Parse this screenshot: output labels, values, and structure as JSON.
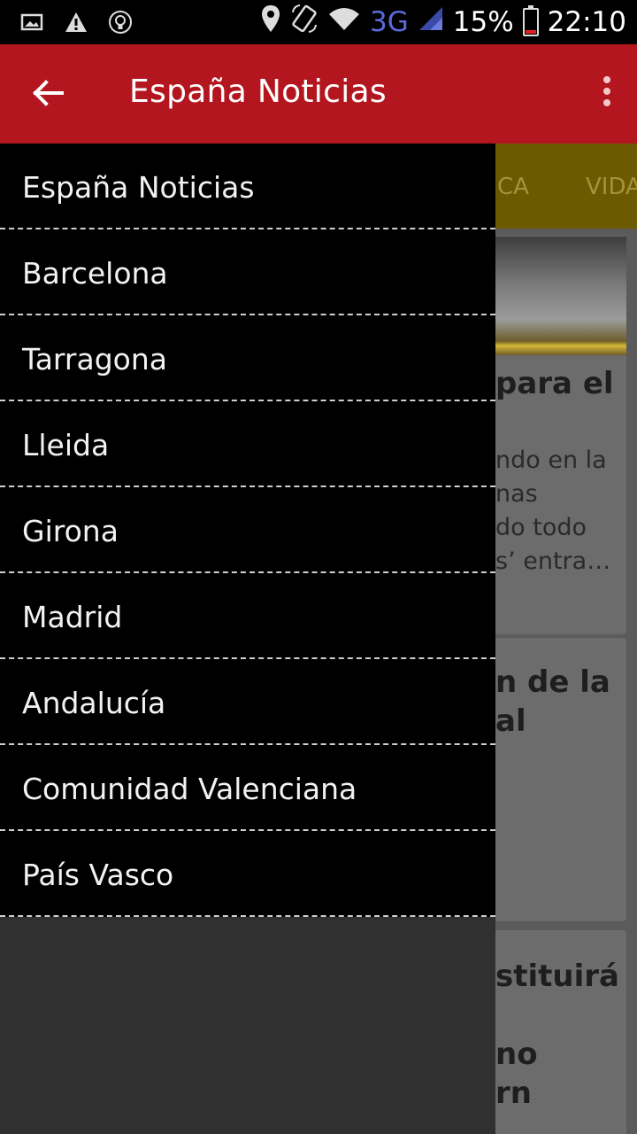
{
  "status_bar": {
    "icons_left": [
      "image-icon",
      "warning-icon",
      "lightbulb-icon"
    ],
    "network": "3G",
    "battery_percent": "15%",
    "battery_level": 0.15,
    "time": "22:10"
  },
  "app_bar": {
    "title": "España Noticias",
    "color": "#b3161f"
  },
  "background": {
    "tabs": [
      "CA",
      "VIDA"
    ],
    "cards": [
      {
        "title_lines": [
          "para el"
        ],
        "body_lines": [
          "ndo en la",
          "nas",
          "do todo",
          "s’ entra…"
        ]
      },
      {
        "title_lines": [
          "n de la",
          "al"
        ],
        "body_lines": []
      },
      {
        "title_lines": [
          "stituirá",
          "",
          "no",
          "rn"
        ],
        "body_lines": []
      }
    ]
  },
  "drawer": {
    "items": [
      "España Noticias",
      "Barcelona",
      "Tarragona",
      "Lleida",
      "Girona",
      "Madrid",
      "Andalucía",
      "Comunidad Valenciana",
      "País Vasco"
    ]
  }
}
